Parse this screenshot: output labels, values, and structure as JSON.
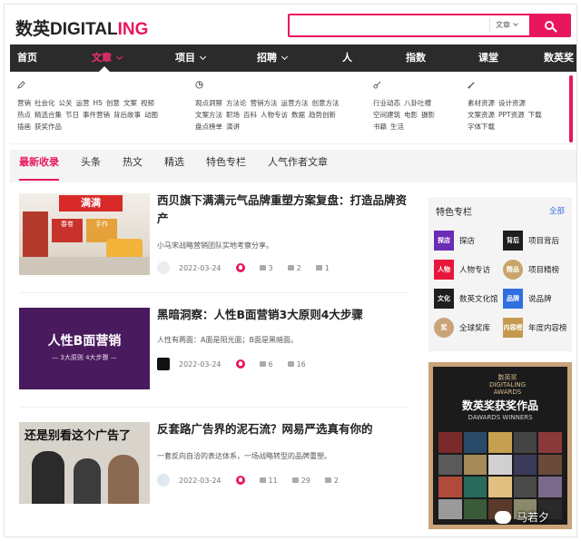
{
  "header": {
    "logo_cn": "数英",
    "logo_en_1": "DIGITAL",
    "logo_en_2": "ING",
    "search_placeholder": "",
    "search_type": "文章"
  },
  "nav": {
    "items": [
      "首页",
      "文章",
      "项目",
      "招聘",
      "人",
      "指数",
      "课堂",
      "数英奖"
    ],
    "active": "文章",
    "bg": "#2b2b2b",
    "accent": "#e8175d"
  },
  "panel": {
    "columns": [
      {
        "icon": "pen-icon",
        "rows": [
          [
            "营销",
            "社会化",
            "公关",
            "运营",
            "H5",
            "创意",
            "文案",
            "视频"
          ],
          [
            "热点",
            "精选合集",
            "节日",
            "事件营销",
            "背后故事",
            "动图"
          ],
          [
            "插画",
            "获奖作品"
          ]
        ]
      },
      {
        "icon": "chart-icon",
        "rows": [
          [
            "观点洞察",
            "方法论",
            "营销方法",
            "运营方法",
            "创意方法"
          ],
          [
            "文案方法",
            "职场",
            "百科",
            "人物专访",
            "数据",
            "趋势创新"
          ],
          [
            "盘点榜单",
            "演讲"
          ]
        ]
      },
      {
        "icon": "paint-icon",
        "rows": [
          [
            "行业动态",
            "八卦吐槽"
          ],
          [
            "空间建筑",
            "电影",
            "摄影"
          ],
          [
            "书籍",
            "生活"
          ]
        ]
      },
      {
        "icon": "brush-icon",
        "rows": [
          [
            "素材资源",
            "设计资源"
          ],
          [
            "文案资源",
            "PPT资源",
            "下载"
          ],
          [
            "字体下载"
          ]
        ]
      }
    ]
  },
  "tabs": {
    "items": [
      "最新收录",
      "头条",
      "热文",
      "精选",
      "特色专栏",
      "人气作者文章"
    ],
    "active": "最新收录"
  },
  "articles": [
    {
      "title": "西贝旗下满满元气品牌重塑方案复盘：打造品牌资产",
      "desc": "小马宋战略营销团队实地考察分享。",
      "date": "2022-03-24",
      "likes": "3",
      "comments": "2",
      "shares": "1",
      "thumb_sign": "满满",
      "thumb_text_1": "春卷",
      "thumb_text_2": "手作"
    },
    {
      "title": "黑暗洞察：人性B面营销3大原则4大步骤",
      "desc": "人性有两面：A面是阳光面；B面是黑暗面。",
      "date": "2022-03-24",
      "likes": "6",
      "comments": "16",
      "shares": "",
      "thumb_title": "人性B面营销",
      "thumb_sub": "— 3大原则 4大步骤 —"
    },
    {
      "title": "反套路广告界的泥石流？网易严选真有你的",
      "desc": "一套反向自洽的表达体系，一场战略转型的品牌重塑。",
      "date": "2022-03-24",
      "likes": "11",
      "comments": "29",
      "shares": "2",
      "thumb_text": "还是别看这个广告了"
    }
  ],
  "sidebar": {
    "title": "特色专栏",
    "all": "全部",
    "columns": [
      {
        "icon_text": "探店",
        "label": "探店",
        "color": "#6a2bb5"
      },
      {
        "icon_text": "背后",
        "label": "项目背后",
        "color": "#1e1e1e"
      },
      {
        "icon_text": "人物",
        "label": "人物专访",
        "color": "#e8173a"
      },
      {
        "icon_text": "精品",
        "label": "项目精榜",
        "color": "#c9a56a"
      },
      {
        "icon_text": "文化",
        "label": "数英文化馆",
        "color": "#1e1e1e"
      },
      {
        "icon_text": "品牌",
        "label": "说品牌",
        "color": "#2f6fe0"
      },
      {
        "icon_text": "奖",
        "label": "全球奖库",
        "color": "#caa37a"
      },
      {
        "icon_text": "内容榜",
        "label": "年度内容榜",
        "color": "#c59a4e"
      }
    ]
  },
  "awards": {
    "logo_1": "数英奖",
    "logo_2": "DIGITALING",
    "logo_3": "AWARDS",
    "title": "数英奖获奖作品",
    "subtitle": "DAWARDS WINNERS"
  },
  "watermark": "马若夕"
}
